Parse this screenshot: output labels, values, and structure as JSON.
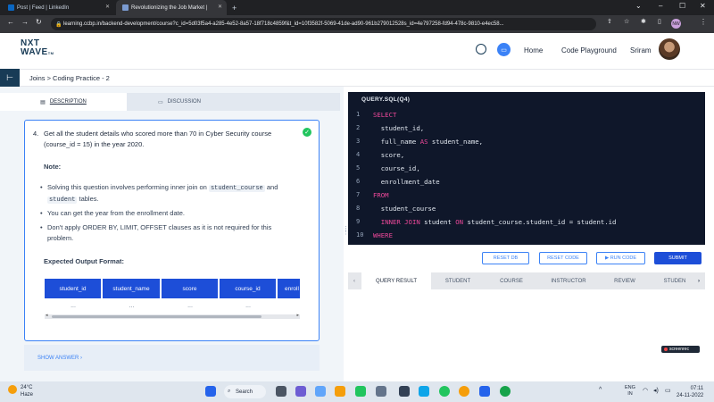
{
  "browser": {
    "tabs": [
      {
        "label": "Post | Feed | LinkedIn"
      },
      {
        "label": "Revolutionizing the Job Market |"
      }
    ],
    "new_tab": "+",
    "url": "learning.ccbp.in/backend-development/course?c_id=5d03f5a4-a285-4e52-8a57-18f718c4859f&t_id=10f3582f-5069-41de-ad90-961b279012528s_id=4e797258-fd94-478c-9810-e4ec58...",
    "profile_badge": "NW"
  },
  "header": {
    "logo_line1": "NXT",
    "logo_line2": "WAVE",
    "logo_tm": "TM",
    "nav": {
      "home": "Home",
      "playground": "Code Playground",
      "user": "Sriram"
    }
  },
  "breadcrumb": "Joins > Coding Practice - 2",
  "left_tabs": {
    "description": "DESCRIPTION",
    "discussion": "DISCUSSION"
  },
  "question": {
    "number": "4.",
    "text": "Get all the student details who scored more than 70 in Cyber Security course (course_id = 15) in the year 2020.",
    "note_heading": "Note:",
    "bullet1_pre": "Solving this question involves performing inner join on",
    "bullet1_t1": "student_course",
    "bullet1_mid": "and",
    "bullet1_t2": "student",
    "bullet1_post": "tables.",
    "bullet2": "You can get the year from the enrollment date.",
    "bullet3": "Don't apply ORDER BY, LIMIT, OFFSET clauses as it is not required for this problem.",
    "expected_heading": "Expected Output Format:",
    "columns": [
      "student_id",
      "student_name",
      "score",
      "course_id",
      "enroll"
    ],
    "row": [
      "...",
      "...",
      "...",
      "...",
      ""
    ]
  },
  "show_answer": "SHOW ANSWER ›",
  "editor": {
    "title": "QUERY.SQL(Q4)",
    "line_numbers": [
      "1",
      "2",
      "3",
      "4",
      "5",
      "6",
      "7",
      "8",
      "9",
      "10"
    ],
    "lines": [
      {
        "kw": "SELECT",
        "rest": ""
      },
      {
        "kw": "",
        "rest": "  student_id,"
      },
      {
        "kw": "",
        "rest": "  full_name AS student_name,"
      },
      {
        "kw": "",
        "rest": "  score,"
      },
      {
        "kw": "",
        "rest": "  course_id,"
      },
      {
        "kw": "",
        "rest": "  enrollment_date"
      },
      {
        "kw": "FROM",
        "rest": ""
      },
      {
        "kw": "",
        "rest": "  student_course"
      },
      {
        "kw": "",
        "rest": "  INNER JOIN student ON student_course.student_id = student.id"
      },
      {
        "kw": "WHERE",
        "rest": ""
      }
    ]
  },
  "buttons": {
    "reset_db": "RESET DB",
    "reset_code": "RESET CODE",
    "run_code": "▶ RUN CODE",
    "submit": "SUBMIT"
  },
  "result_tabs": [
    "QUERY RESULT",
    "STUDENT",
    "COURSE",
    "INSTRUCTOR",
    "REVIEW",
    "STUDEN"
  ],
  "screenrec": "screenrec",
  "taskbar": {
    "temp": "24°C",
    "weather": "Haze",
    "search": "Search",
    "lang1": "ENG",
    "lang2": "IN",
    "time": "07:11",
    "date": "24-11-2022"
  },
  "colors": {
    "brand_dark": "#183b56",
    "primary": "#1d4ed8",
    "keyword": "#ec4899",
    "success": "#22c55e"
  }
}
